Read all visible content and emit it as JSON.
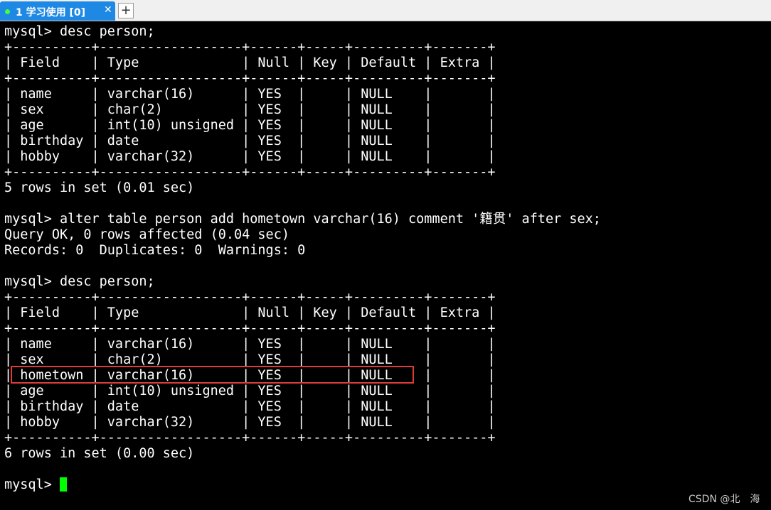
{
  "tabbar": {
    "tab_label": "1 学习使用 [0]",
    "close_glyph": "✕",
    "add_glyph": "+"
  },
  "terminal": {
    "lines": [
      "mysql> desc person;",
      "+----------+------------------+------+-----+---------+-------+",
      "| Field    | Type             | Null | Key | Default | Extra |",
      "+----------+------------------+------+-----+---------+-------+",
      "| name     | varchar(16)      | YES  |     | NULL    |       |",
      "| sex      | char(2)          | YES  |     | NULL    |       |",
      "| age      | int(10) unsigned | YES  |     | NULL    |       |",
      "| birthday | date             | YES  |     | NULL    |       |",
      "| hobby    | varchar(32)      | YES  |     | NULL    |       |",
      "+----------+------------------+------+-----+---------+-------+",
      "5 rows in set (0.01 sec)",
      "",
      "mysql> alter table person add hometown varchar(16) comment '籍贯' after sex;",
      "Query OK, 0 rows affected (0.04 sec)",
      "Records: 0  Duplicates: 0  Warnings: 0",
      "",
      "mysql> desc person;",
      "+----------+------------------+------+-----+---------+-------+",
      "| Field    | Type             | Null | Key | Default | Extra |",
      "+----------+------------------+------+-----+---------+-------+",
      "| name     | varchar(16)      | YES  |     | NULL    |       |",
      "| sex      | char(2)          | YES  |     | NULL    |       |",
      "| hometown | varchar(16)      | YES  |     | NULL    |       |",
      "| age      | int(10) unsigned | YES  |     | NULL    |       |",
      "| birthday | date             | YES  |     | NULL    |       |",
      "| hobby    | varchar(32)      | YES  |     | NULL    |       |",
      "+----------+------------------+------+-----+---------+-------+",
      "6 rows in set (0.00 sec)",
      ""
    ],
    "prompt": "mysql> "
  },
  "watermark": "CSDN @北　海",
  "colors": {
    "background": "#000000",
    "text": "#ffffff",
    "cursor": "#00ff00",
    "tab_active": "#1e88e5",
    "highlight": "#e03a3a"
  }
}
